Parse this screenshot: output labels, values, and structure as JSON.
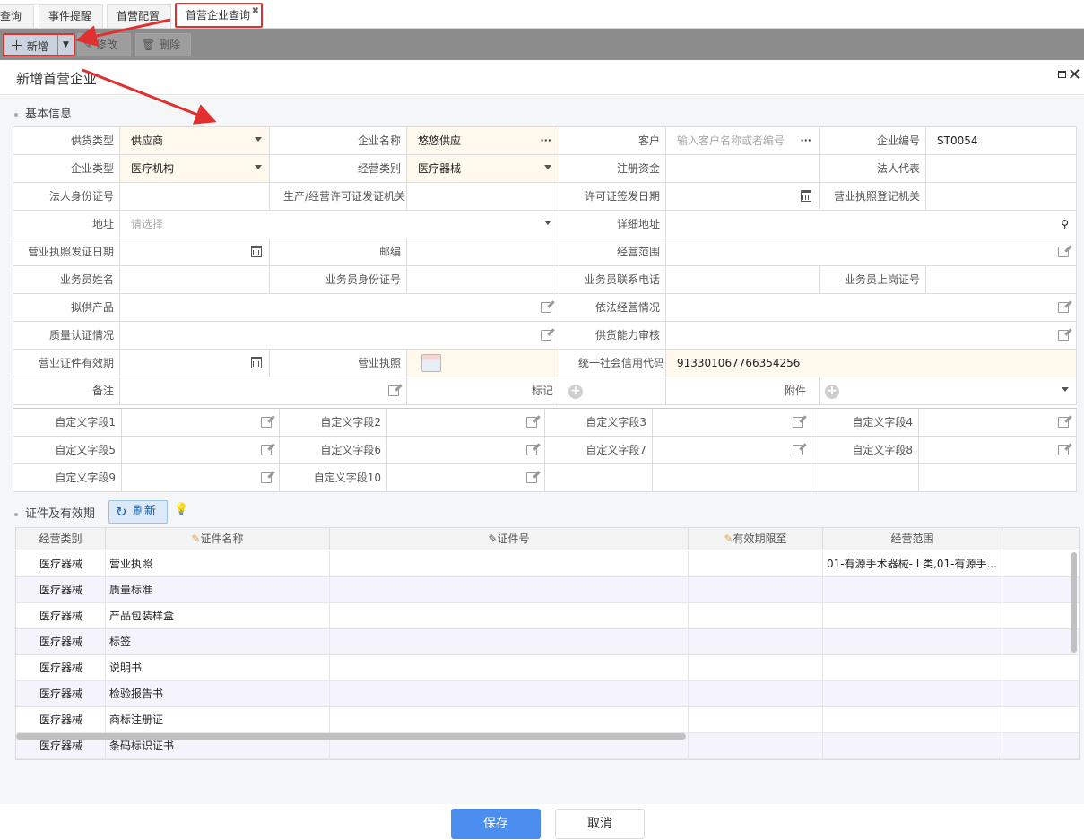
{
  "tabs": [
    "查询",
    "事件提醒",
    "首营配置",
    "首营企业查询"
  ],
  "toolbar": {
    "add": "新增",
    "edit": "修改",
    "delete": "删除"
  },
  "dialog": {
    "title": "新增首营企业"
  },
  "basic": {
    "section_title": "基本信息",
    "supply_type_label": "供货类型",
    "supply_type_value": "供应商",
    "company_name_label": "企业名称",
    "company_name_value": "悠悠供应",
    "customer_label": "客户",
    "customer_placeholder": "输入客户名称或者编号",
    "company_code_label": "企业编号",
    "company_code_value": "ST0054",
    "company_type_label": "企业类型",
    "company_type_value": "医疗机构",
    "business_category_label": "经营类别",
    "business_category_value": "医疗器械",
    "registered_capital_label": "注册资金",
    "legal_rep_label": "法人代表",
    "legal_id_label": "法人身份证号",
    "license_authority_label": "生产/经营许可证发证机关",
    "license_issue_date_label": "许可证签发日期",
    "bizlicense_authority_label": "营业执照登记机关",
    "address_label": "地址",
    "address_placeholder": "请选择",
    "detail_address_label": "详细地址",
    "bizlicense_date_label": "营业执照发证日期",
    "postcode_label": "邮编",
    "business_scope_label": "经营范围",
    "salesman_name_label": "业务员姓名",
    "salesman_id_label": "业务员身份证号",
    "salesman_phone_label": "业务员联系电话",
    "salesman_cert_label": "业务员上岗证号",
    "proposed_products_label": "拟供产品",
    "legal_operation_label": "依法经营情况",
    "quality_cert_label": "质量认证情况",
    "supply_review_label": "供货能力审核",
    "cert_validity_label": "营业证件有效期",
    "bizlicense_label": "营业执照",
    "credit_code_label": "统一社会信用代码",
    "credit_code_value": "913301067766354256",
    "remark_label": "备注",
    "mark_label": "标记",
    "attachment_label": "附件"
  },
  "custom": [
    "自定义字段1",
    "自定义字段2",
    "自定义字段3",
    "自定义字段4",
    "自定义字段5",
    "自定义字段6",
    "自定义字段7",
    "自定义字段8",
    "自定义字段9",
    "自定义字段10"
  ],
  "certs": {
    "section_title": "证件及有效期",
    "refresh": "刷新",
    "headers": [
      "经营类别",
      "证件名称",
      "证件号",
      "有效期限至",
      "经营范围"
    ],
    "rows": [
      {
        "cat": "医疗器械",
        "name": "营业执照",
        "no": "",
        "exp": "",
        "scope": "01-有源手术器械- I 类,01-有源手..."
      },
      {
        "cat": "医疗器械",
        "name": "质量标准",
        "no": "",
        "exp": "",
        "scope": ""
      },
      {
        "cat": "医疗器械",
        "name": "产品包装样盒",
        "no": "",
        "exp": "",
        "scope": ""
      },
      {
        "cat": "医疗器械",
        "name": "标签",
        "no": "",
        "exp": "",
        "scope": ""
      },
      {
        "cat": "医疗器械",
        "name": "说明书",
        "no": "",
        "exp": "",
        "scope": ""
      },
      {
        "cat": "医疗器械",
        "name": "检验报告书",
        "no": "",
        "exp": "",
        "scope": ""
      },
      {
        "cat": "医疗器械",
        "name": "商标注册证",
        "no": "",
        "exp": "",
        "scope": ""
      },
      {
        "cat": "医疗器械",
        "name": "条码标识证书",
        "no": "",
        "exp": "",
        "scope": ""
      }
    ]
  },
  "footer": {
    "save": "保存",
    "cancel": "取消"
  },
  "colors": {
    "highlight": "#fff8ec",
    "primary": "#4b8ef0",
    "annotation": "#e03030"
  }
}
